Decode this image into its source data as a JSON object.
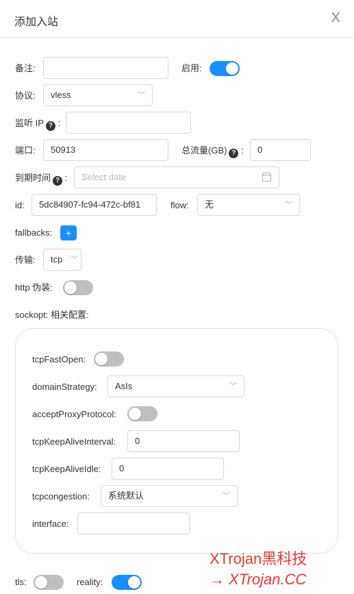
{
  "header": {
    "title": "添加入站",
    "close": "X"
  },
  "form": {
    "remark_label": "备注:",
    "remark_value": "",
    "enable_label": "启用:",
    "enable_on": true,
    "protocol_label": "协议:",
    "protocol_value": "vless",
    "listen_label": "监听 IP",
    "listen_value": "",
    "port_label": "端口:",
    "port_value": "50913",
    "total_label": "总流量(GB)",
    "total_value": "0",
    "expiry_label": "到期时间",
    "expiry_placeholder": "Select date",
    "id_label": "id:",
    "id_value": "5dc84907-fc94-472c-bf81",
    "flow_label": "flow:",
    "flow_value": "无",
    "fallbacks_label": "fallbacks:",
    "fallbacks_add": "+",
    "transport_label": "传输:",
    "transport_value": "tcp",
    "http_label": "http 伪装:",
    "http_on": false,
    "sockopt_label": "sockopt: 相关配置:",
    "tls_label": "tls:",
    "tls_on": false,
    "reality_label": "reality:",
    "reality_on": true
  },
  "sockopt": {
    "tcpfastopen_label": "tcpFastOpen:",
    "tcpfastopen_on": false,
    "domainstrategy_label": "domainStrategy:",
    "domainstrategy_value": "AsIs",
    "acceptproxy_label": "acceptProxyProtocol:",
    "acceptproxy_on": false,
    "keepaliveinterval_label": "tcpKeepAliveInterval:",
    "keepaliveinterval_value": "0",
    "keepaliveidle_label": "tcpKeepAliveIdle:",
    "keepaliveidle_value": "0",
    "congestion_label": "tcpcongestion:",
    "congestion_value": "系统默认",
    "interface_label": "interface:",
    "interface_value": ""
  },
  "watermark": {
    "line1": "XTrojan黑科技",
    "line2": "→ XTrojan.CC"
  },
  "icons": {
    "help": "?",
    "chevron": "﹀",
    "close": "X",
    "calendar": "calendar-icon"
  }
}
